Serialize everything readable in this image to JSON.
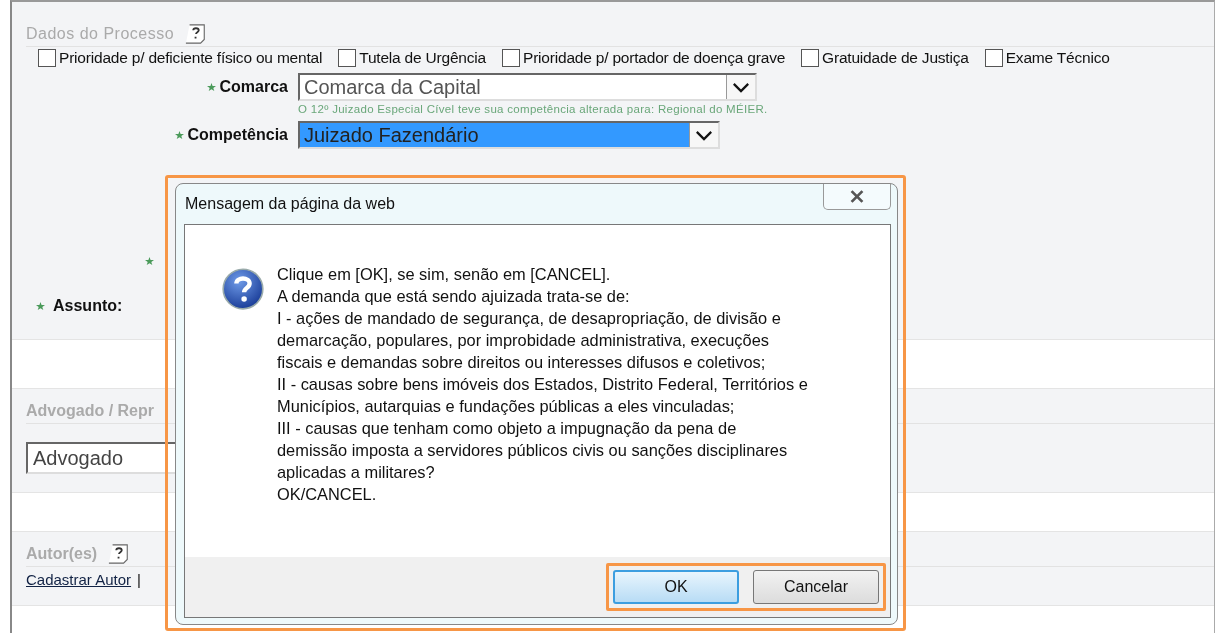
{
  "process": {
    "title": "Dados do Processo",
    "options": [
      {
        "label": "Prioridade p/ deficiente físico ou mental",
        "checked": false
      },
      {
        "label": "Tutela de Urgência",
        "checked": false
      },
      {
        "label": "Prioridade p/ portador de doença grave",
        "checked": false
      },
      {
        "label": "Gratuidade de Justiça",
        "checked": false
      },
      {
        "label": "Exame Técnico",
        "checked": false
      }
    ],
    "fields": [
      {
        "label": "Comarca",
        "value": "Comarca da Capital",
        "required": true,
        "highlighted": false,
        "hint": "O 12º Juizado Especial Cível teve sua competência alterada para: Regional do MÉIER."
      },
      {
        "label": "Competência",
        "value": "Juizado Fazendário",
        "required": true,
        "highlighted": true
      }
    ],
    "partial_label": {
      "required": true
    },
    "subject": {
      "label": "Assunto:",
      "required": true
    }
  },
  "lawyer": {
    "title": "Advogado / Repr",
    "value": "Advogado"
  },
  "authors": {
    "title": "Autor(es)",
    "links": [
      "Cadastrar Autor"
    ],
    "separator": "|"
  },
  "dialog": {
    "title": "Mensagem da página da web",
    "message": "Clique em [OK], se sim, senão em [CANCEL].\nA demanda que está sendo ajuizada trata-se de:\nI - ações de mandado de segurança, de desapropriação, de divisão e\ndemarcação, populares, por improbidade administrativa, execuções\nfiscais e demandas sobre direitos ou interesses difusos e coletivos;\nII - causas sobre bens imóveis dos Estados, Distrito Federal, Territórios e\nMunicípios, autarquias e fundações públicas a eles vinculadas;\nIII - causas que tenham como objeto a impugnação da pena de\ndemissão imposta a servidores públicos civis ou sanções disciplinares\naplicadas a militares?\nOK/CANCEL.",
    "buttons": [
      {
        "label": "OK",
        "selected": true
      },
      {
        "label": "Cancelar",
        "selected": false
      }
    ]
  }
}
